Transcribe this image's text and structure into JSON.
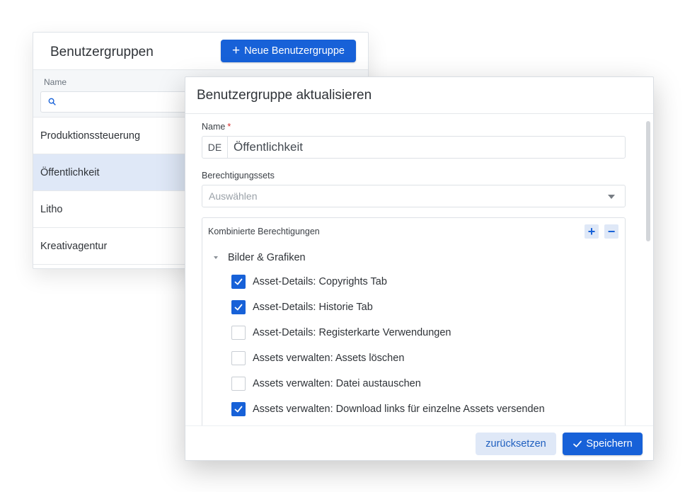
{
  "colors": {
    "accent": "#1761d8",
    "accent_light": "#dfe8f7",
    "required": "#d62b2b"
  },
  "groups_panel": {
    "title": "Benutzergruppen",
    "new_button_label": "Neue Benutzergruppe",
    "new_button_icon": "plus-icon",
    "column_name": "Name",
    "search_icon": "search-icon",
    "search_placeholder": "",
    "rows": [
      {
        "label": "Produktionssteuerung",
        "selected": false
      },
      {
        "label": "Öffentlichkeit",
        "selected": true
      },
      {
        "label": "Litho",
        "selected": false
      },
      {
        "label": "Kreativagentur",
        "selected": false
      }
    ]
  },
  "dialog": {
    "title": "Benutzergruppe aktualisieren",
    "name_label": "Name",
    "required_marker": "*",
    "language_code": "DE",
    "name_value": "Öffentlichkeit",
    "permission_sets_label": "Berechtigungssets",
    "permission_sets_placeholder": "Auswählen",
    "combined_permissions_label": "Kombinierte Berechtigungen",
    "expand_all_icon": "plus-icon",
    "collapse_all_icon": "minus-icon",
    "group": {
      "label": "Bilder & Grafiken",
      "icon": "chevron-down-icon",
      "permissions": [
        {
          "label": "Asset-Details: Copyrights Tab",
          "checked": true
        },
        {
          "label": "Asset-Details: Historie Tab",
          "checked": true
        },
        {
          "label": "Asset-Details: Registerkarte Verwendungen",
          "checked": false
        },
        {
          "label": "Assets verwalten: Assets löschen",
          "checked": false
        },
        {
          "label": "Assets verwalten: Datei austauschen",
          "checked": false
        },
        {
          "label": "Assets verwalten: Download links für einzelne Assets versenden",
          "checked": true
        }
      ]
    },
    "reset_label": "zurücksetzen",
    "save_label": "Speichern",
    "save_icon": "check-icon"
  }
}
